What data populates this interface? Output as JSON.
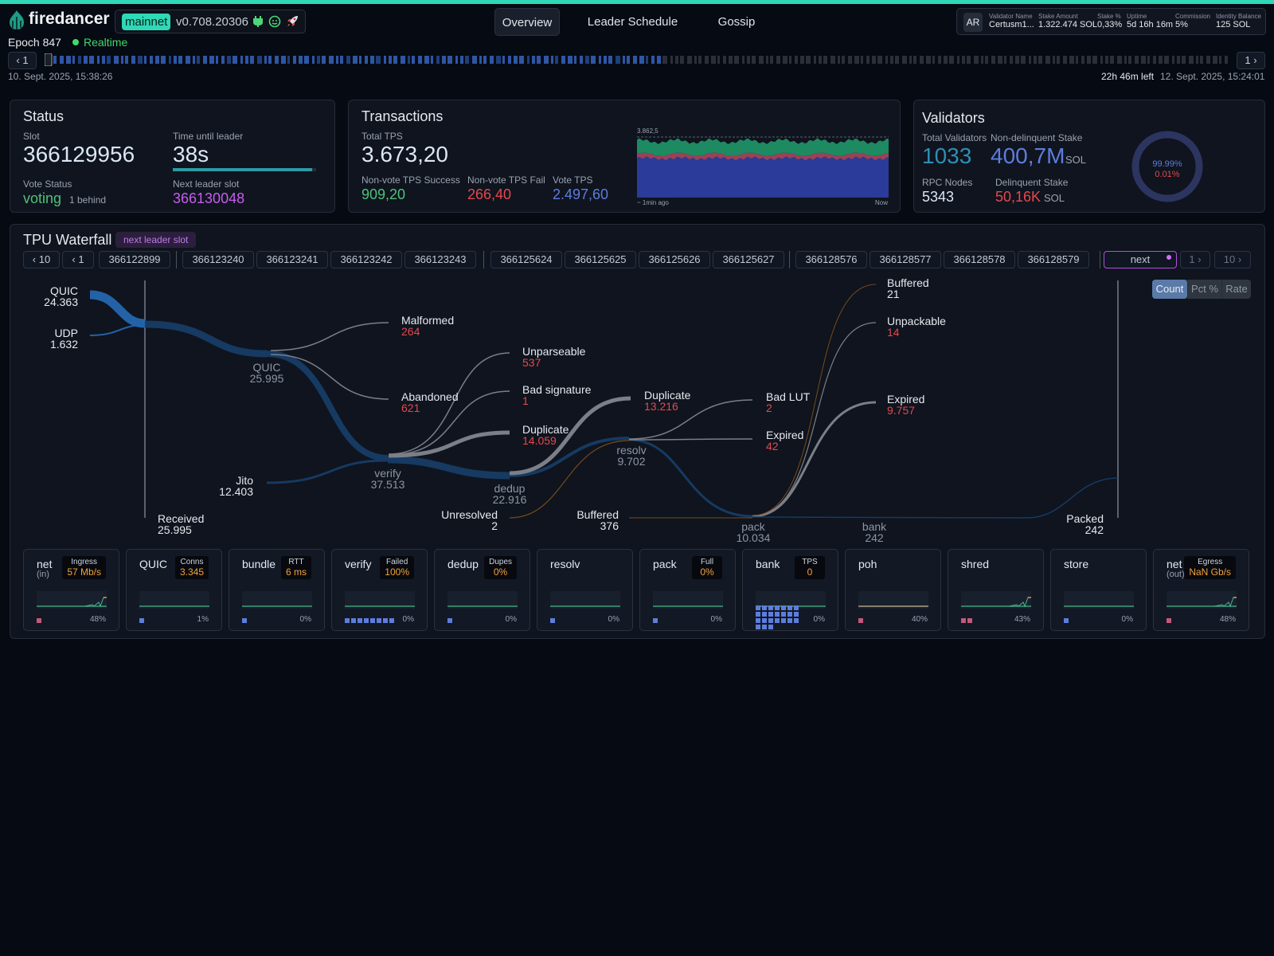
{
  "header": {
    "brand": "firedancer",
    "network": "mainnet",
    "version": "v0.708.20306",
    "tabs": [
      {
        "label": "Overview",
        "active": true
      },
      {
        "label": "Leader Schedule",
        "active": false
      },
      {
        "label": "Gossip",
        "active": false
      }
    ],
    "identity": {
      "avatar": "AR",
      "fields": [
        {
          "label": "Validator Name",
          "value": "Certusm1..."
        },
        {
          "label": "Stake Amount",
          "value": "1.322.474 SOL"
        },
        {
          "label": "Stake %",
          "value": "0,33%"
        },
        {
          "label": "Uptime",
          "value": "5d 16h 16m"
        },
        {
          "label": "Commission",
          "value": "5%"
        },
        {
          "label": "Identity Balance",
          "value": "125 SOL"
        }
      ]
    }
  },
  "epoch": {
    "label": "Epoch 847",
    "realtime": "Realtime",
    "prev_label": "1",
    "next_label": "1",
    "start_time": "10. Sept. 2025, 15:38:26",
    "time_left": "22h 46m left",
    "end_time": "12. Sept. 2025, 15:24:01",
    "progress": 0.52
  },
  "status": {
    "title": "Status",
    "slot_label": "Slot",
    "slot": "366129956",
    "time_label": "Time until leader",
    "time_value": "38s",
    "time_progress": 0.97,
    "vote_label": "Vote Status",
    "vote_value": "voting",
    "vote_behind": "1 behind",
    "next_label": "Next leader slot",
    "next_value": "366130048"
  },
  "transactions": {
    "title": "Transactions",
    "total_label": "Total TPS",
    "total_value": "3.673,20",
    "nv_success_label": "Non-vote TPS Success",
    "nv_success_value": "909,20",
    "nv_fail_label": "Non-vote TPS Fail",
    "nv_fail_value": "266,40",
    "vote_label": "Vote TPS",
    "vote_value": "2.497,60",
    "chart_max": "3.862,5",
    "chart_left": "~ 1min ago",
    "chart_right": "Now"
  },
  "validators": {
    "title": "Validators",
    "total_label": "Total Validators",
    "total_value": "1033",
    "stake_label": "Non-delinquent Stake",
    "stake_value": "400,7M",
    "stake_unit": "SOL",
    "rpc_label": "RPC Nodes",
    "rpc_value": "5343",
    "delinq_label": "Delinquent Stake",
    "delinq_value": "50,16K",
    "delinq_unit": "SOL",
    "donut_active": "99.99%",
    "donut_delinq": "0.01%",
    "active_fraction": 0.9999
  },
  "waterfall": {
    "title": "TPU Waterfall",
    "tag": "next leader slot",
    "back10": "10",
    "back1": "1",
    "fwd1": "1",
    "fwd10": "10",
    "next": "next",
    "slot_groups": [
      [
        "366122899"
      ],
      [
        "366123240",
        "366123241",
        "366123242",
        "366123243"
      ],
      [
        "366125624",
        "366125625",
        "366125626",
        "366125627"
      ],
      [
        "366128576",
        "366128577",
        "366128578",
        "366128579"
      ]
    ],
    "modes": [
      "Count",
      "Pct %",
      "Rate"
    ],
    "nodes": {
      "quic_in": {
        "label": "QUIC",
        "value": "24.363"
      },
      "udp_in": {
        "label": "UDP",
        "value": "1.632"
      },
      "received": {
        "label": "Received",
        "value": "25.995"
      },
      "quic": {
        "label": "QUIC",
        "value": "25.995"
      },
      "jito": {
        "label": "Jito",
        "value": "12.403"
      },
      "malformed": {
        "label": "Malformed",
        "value": "264"
      },
      "abandoned": {
        "label": "Abandoned",
        "value": "621"
      },
      "verify": {
        "label": "verify",
        "value": "37.513"
      },
      "unparseable": {
        "label": "Unparseable",
        "value": "537"
      },
      "badsig": {
        "label": "Bad signature",
        "value": "1"
      },
      "dup1": {
        "label": "Duplicate",
        "value": "14.059"
      },
      "dedup": {
        "label": "dedup",
        "value": "22.916"
      },
      "unresolved": {
        "label": "Unresolved",
        "value": "2"
      },
      "dup2": {
        "label": "Duplicate",
        "value": "13.216"
      },
      "resolv": {
        "label": "resolv",
        "value": "9.702"
      },
      "buffered1": {
        "label": "Buffered",
        "value": "376"
      },
      "badlut": {
        "label": "Bad LUT",
        "value": "2"
      },
      "expired1": {
        "label": "Expired",
        "value": "42"
      },
      "pack": {
        "label": "pack",
        "value": "10.034"
      },
      "buffered2": {
        "label": "Buffered",
        "value": "21"
      },
      "unpackable": {
        "label": "Unpackable",
        "value": "14"
      },
      "expired2": {
        "label": "Expired",
        "value": "9.757"
      },
      "bank": {
        "label": "bank",
        "value": "242"
      },
      "packed": {
        "label": "Packed",
        "value": "242"
      }
    }
  },
  "tiles": [
    {
      "name": "net",
      "sub": "(in)",
      "badge_label": "Ingress",
      "badge_value": "57 Mb/s",
      "pct": "48%",
      "dot": "#c4587a",
      "dots": 1
    },
    {
      "name": "QUIC",
      "sub": "",
      "badge_label": "Conns",
      "badge_value": "3.345",
      "pct": "1%",
      "dot": "#5d7ddd",
      "dots": 1
    },
    {
      "name": "bundle",
      "sub": "",
      "badge_label": "RTT",
      "badge_value": "6 ms",
      "pct": "0%",
      "dot": "#5d7ddd",
      "dots": 1
    },
    {
      "name": "verify",
      "sub": "",
      "badge_label": "Failed",
      "badge_value": "100%",
      "pct": "0%",
      "dot": "#5d7ddd",
      "dots": 8
    },
    {
      "name": "dedup",
      "sub": "",
      "badge_label": "Dupes",
      "badge_value": "0%",
      "pct": "0%",
      "dot": "#5d7ddd",
      "dots": 1
    },
    {
      "name": "resolv",
      "sub": "",
      "badge_label": "",
      "badge_value": "",
      "pct": "0%",
      "dot": "#5d7ddd",
      "dots": 1
    },
    {
      "name": "pack",
      "sub": "",
      "badge_label": "Full",
      "badge_value": "0%",
      "pct": "0%",
      "dot": "#5d7ddd",
      "dots": 1
    },
    {
      "name": "bank",
      "sub": "",
      "badge_label": "TPS",
      "badge_value": "0",
      "pct": "0%",
      "dot": "#5d7ddd",
      "dots": 24
    },
    {
      "name": "poh",
      "sub": "",
      "badge_label": "",
      "badge_value": "",
      "pct": "40%",
      "dot": "#c4587a",
      "dots": 1
    },
    {
      "name": "shred",
      "sub": "",
      "badge_label": "",
      "badge_value": "",
      "pct": "43%",
      "dot": "#c4587a",
      "dots": 2
    },
    {
      "name": "store",
      "sub": "",
      "badge_label": "",
      "badge_value": "",
      "pct": "0%",
      "dot": "#5d7ddd",
      "dots": 1
    },
    {
      "name": "net",
      "sub": "(out)",
      "badge_label": "Egress",
      "badge_value": "NaN Gb/s",
      "pct": "48%",
      "dot": "#c4587a",
      "dots": 1
    }
  ],
  "icons": {
    "logo": "flame-logo-icon",
    "status": [
      "plug-icon",
      "smile-icon",
      "rocket-icon"
    ]
  },
  "colors": {
    "accent": "#2fd8b6",
    "tps_vote": "#2b3b9a",
    "tps_success": "#1e8a62",
    "tps_fail": "#9a4257"
  }
}
